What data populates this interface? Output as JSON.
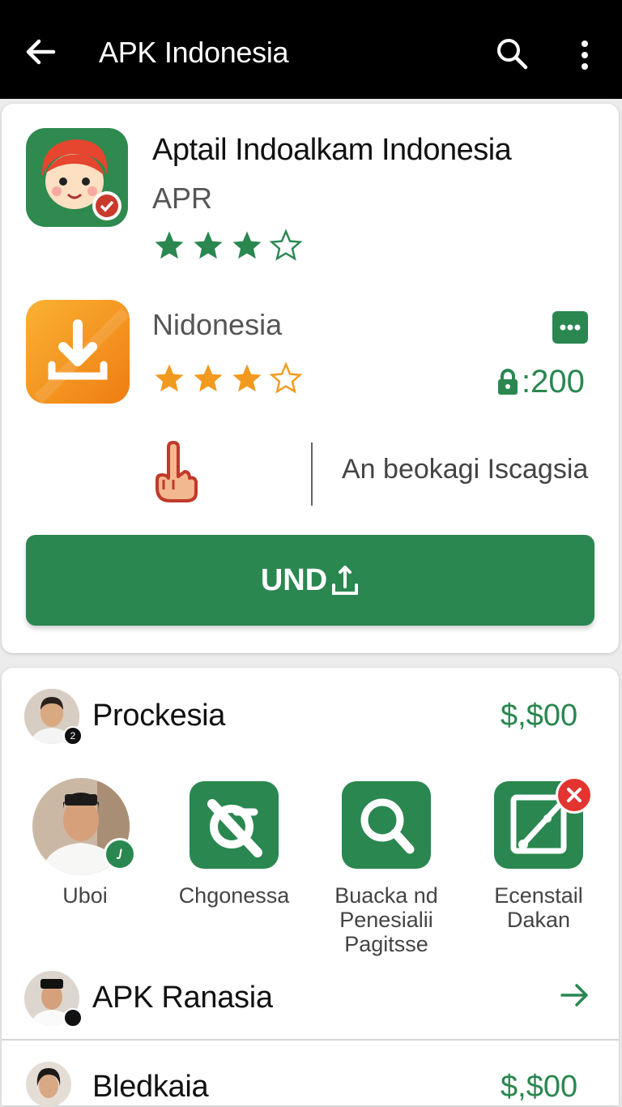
{
  "appbar": {
    "title": "APK Indonesia"
  },
  "featured": {
    "app1": {
      "name": "Aptail Indoalkam Indonesia",
      "publisher": "APR",
      "rating": 3
    },
    "app2": {
      "name": "Nidonesia",
      "rating": 3,
      "price": ":200"
    },
    "info_text": "An beokagi Iscagsia",
    "install_label": "UND"
  },
  "list": {
    "row1": {
      "title": "Prockesia",
      "price": "$,$00",
      "avatar_badge": "2"
    },
    "shortcuts": [
      {
        "label": "Uboi"
      },
      {
        "label": "Chgonessa"
      },
      {
        "label": "Buacka nd Penesialii Pagitsse"
      },
      {
        "label": "Ecenstail Dakan"
      }
    ],
    "row2": {
      "title": "APK Ranasia"
    },
    "row3": {
      "title": "Bledkaia",
      "price": "$,$00"
    }
  },
  "colors": {
    "accent": "#2a8750",
    "orange": "#f08a1c",
    "appbar": "#000000"
  }
}
